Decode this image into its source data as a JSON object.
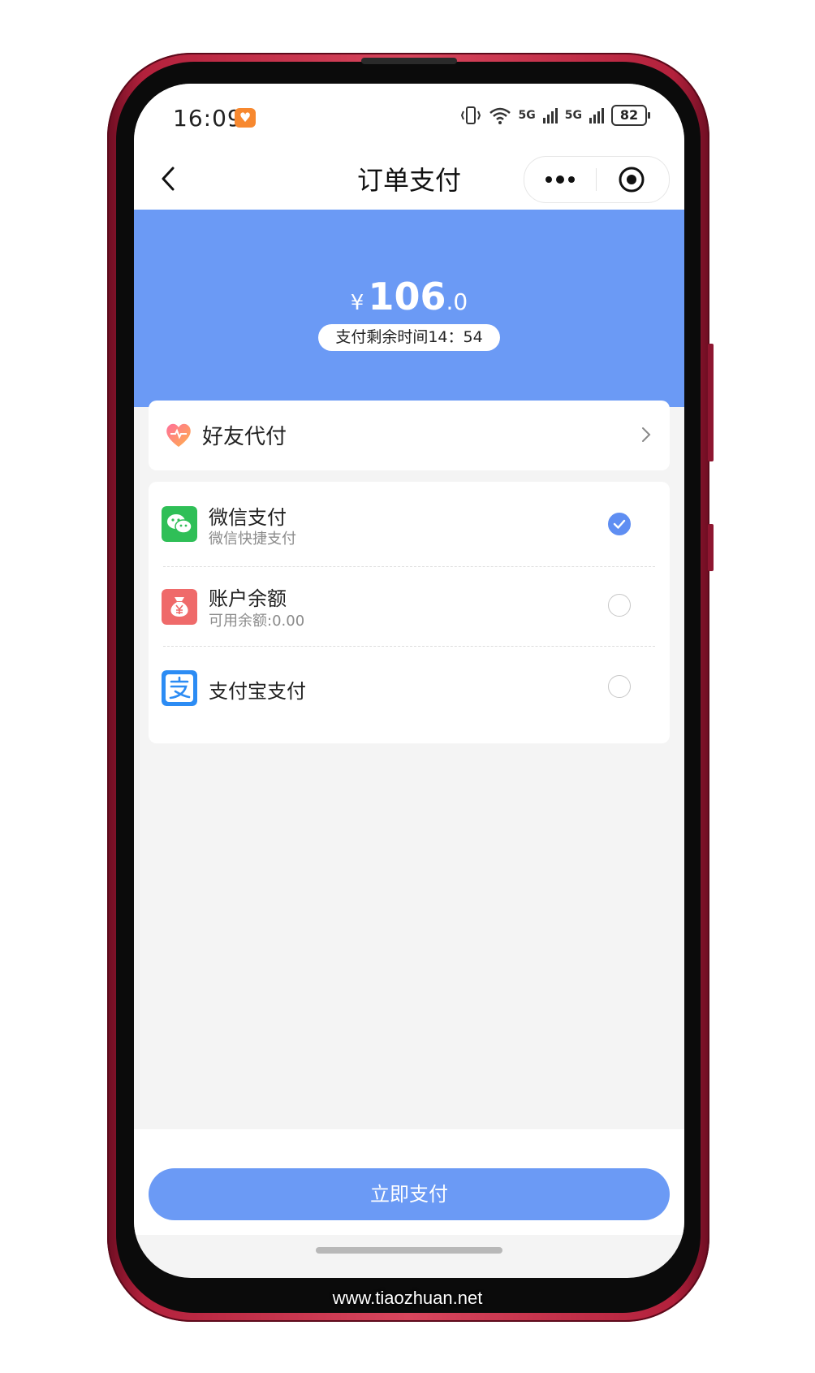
{
  "status_bar": {
    "time": "16:09",
    "signal_1": "5G",
    "signal_2": "5G",
    "battery": "82"
  },
  "nav": {
    "title": "订单支付"
  },
  "payment": {
    "currency": "¥",
    "amount_int": "106",
    "amount_dec": ".0",
    "countdown": "支付剩余时间14：54"
  },
  "friend_pay": {
    "label": "好友代付"
  },
  "methods": [
    {
      "title": "微信支付",
      "subtitle": "微信快捷支付",
      "selected": true,
      "icon": "wechat-icon",
      "color": "#2fbf57"
    },
    {
      "title": "账户余额",
      "subtitle": "可用余额:0.00",
      "selected": false,
      "icon": "money-bag-icon",
      "color": "#ef6a6a"
    },
    {
      "title": "支付宝支付",
      "subtitle": "",
      "selected": false,
      "icon": "alipay-icon",
      "color": "#2c8cf4"
    }
  ],
  "pay_button": {
    "label": "立即支付"
  },
  "theme": {
    "accent": "#6b9af5",
    "background": "#f4f4f4"
  },
  "watermark": "www.tiaozhuan.net"
}
